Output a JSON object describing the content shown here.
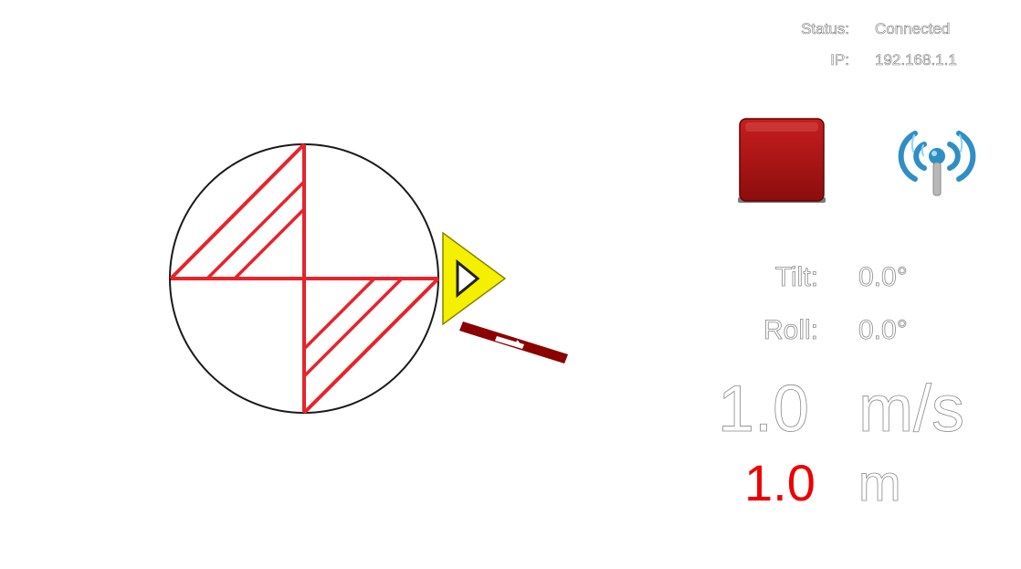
{
  "status": {
    "status_label": "Status:",
    "status_value": "Connected",
    "ip_label": "IP:",
    "ip_value": "192.168.1.1"
  },
  "controls": {
    "stop_icon": "stop-square-icon",
    "wifi_icon": "wireless-signal-icon",
    "stop_color": "#b01717"
  },
  "readings": {
    "tilt_label": "Tilt:",
    "tilt_value": "0.0°",
    "roll_label": "Roll:",
    "roll_value": "0.0°",
    "speed_value": "1.0",
    "speed_unit": "m/s",
    "distance_value": "1.0",
    "distance_unit": "m"
  },
  "colors": {
    "accent_red": "#e8232a",
    "distance_red": "#ee0000",
    "marker_yellow": "#f5ef00",
    "needle_dark_red": "#8b0000"
  }
}
